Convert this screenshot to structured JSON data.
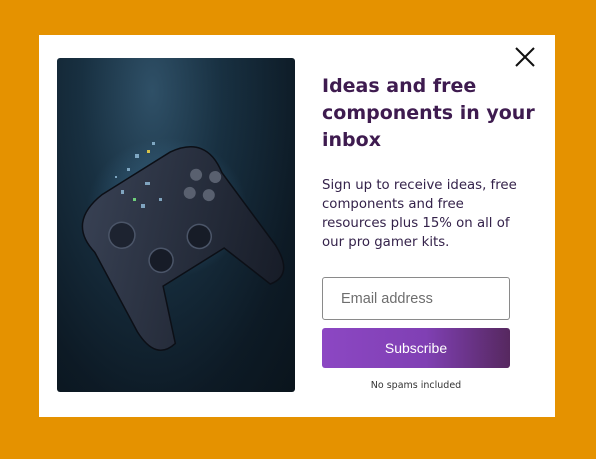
{
  "modal": {
    "close_icon": "close-icon",
    "image_icon": "gamepad-icon",
    "heading": "Ideas and free components in your inbox",
    "description": "Sign up to receive ideas, free components and free resources plus 15% on all of our pro gamer kits.",
    "email_placeholder": "Email address",
    "email_value": "",
    "subscribe_label": "Subscribe",
    "footnote": "No spams included"
  },
  "colors": {
    "background": "#e59200",
    "modal": "#ffffff",
    "heading": "#3e1b4f",
    "button_start": "#8c47c3",
    "button_end": "#56285f"
  }
}
